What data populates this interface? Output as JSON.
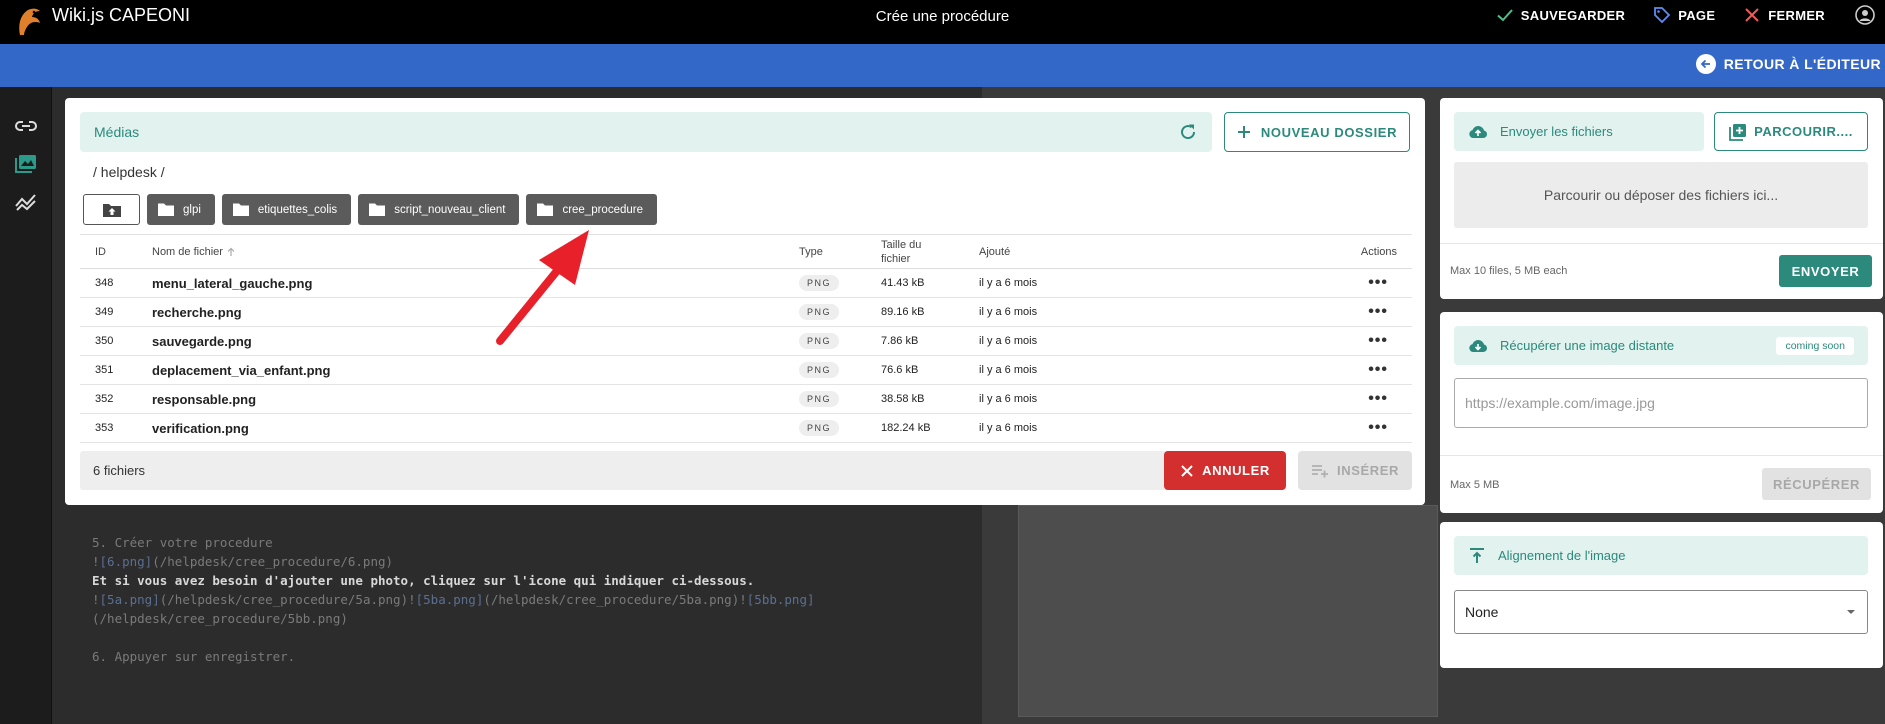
{
  "app": {
    "title": "Wiki.js CAPEONI",
    "page_title": "Crée une procédure"
  },
  "top_actions": {
    "save": "SAUVEGARDER",
    "page": "PAGE",
    "close": "FERMER"
  },
  "blue_bar": {
    "back_label": "RETOUR À L'ÉDITEUR"
  },
  "editor": {
    "lines": [
      {
        "parts": [
          {
            "t": "5. Créer votre procedure",
            "c": ""
          }
        ]
      },
      {
        "parts": [
          {
            "t": "!",
            "c": ""
          },
          {
            "t": "[6.png]",
            "c": "lnk"
          },
          {
            "t": "(/helpdesk/cree_procedure/6.png)",
            "c": ""
          }
        ]
      },
      {
        "parts": [
          {
            "t": "Et si vous avez besoin d'ajouter une photo, cliquez sur l'icone qui indiquer ci-dessous.",
            "c": "bright"
          }
        ]
      },
      {
        "parts": [
          {
            "t": "!",
            "c": ""
          },
          {
            "t": "[5a.png]",
            "c": "lnk"
          },
          {
            "t": "(/helpdesk/cree_procedure/5a.png)!",
            "c": ""
          },
          {
            "t": "[5ba.png]",
            "c": "lnk"
          },
          {
            "t": "(/helpdesk/cree_procedure/5ba.png)!",
            "c": ""
          },
          {
            "t": "[5bb.png]",
            "c": "lnk"
          }
        ]
      },
      {
        "parts": [
          {
            "t": "(/helpdesk/cree_procedure/5bb.png)",
            "c": ""
          }
        ]
      },
      {
        "parts": [
          {
            "t": " ",
            "c": ""
          }
        ]
      },
      {
        "parts": [
          {
            "t": "6. Appuyer sur enregistrer.",
            "c": ""
          }
        ]
      }
    ]
  },
  "media": {
    "label": "Médias",
    "new_folder": "NOUVEAU DOSSIER",
    "breadcrumb": "/ helpdesk /",
    "folders": [
      "glpi",
      "etiquettes_colis",
      "script_nouveau_client",
      "cree_procedure"
    ],
    "columns": {
      "id": "ID",
      "name": "Nom de fichier",
      "type": "Type",
      "size_line1": "Taille du",
      "size_line2": "fichier",
      "added": "Ajouté",
      "actions": "Actions"
    },
    "files": [
      {
        "id": "348",
        "name": "menu_lateral_gauche.png",
        "type": "PNG",
        "size": "41.43 kB",
        "added": "il y a 6 mois"
      },
      {
        "id": "349",
        "name": "recherche.png",
        "type": "PNG",
        "size": "89.16 kB",
        "added": "il y a 6 mois"
      },
      {
        "id": "350",
        "name": "sauvegarde.png",
        "type": "PNG",
        "size": "7.86 kB",
        "added": "il y a 6 mois"
      },
      {
        "id": "351",
        "name": "deplacement_via_enfant.png",
        "type": "PNG",
        "size": "76.6 kB",
        "added": "il y a 6 mois"
      },
      {
        "id": "352",
        "name": "responsable.png",
        "type": "PNG",
        "size": "38.58 kB",
        "added": "il y a 6 mois"
      },
      {
        "id": "353",
        "name": "verification.png",
        "type": "PNG",
        "size": "182.24 kB",
        "added": "il y a 6 mois"
      }
    ],
    "file_count": "6 fichiers",
    "cancel": "ANNULER",
    "insert": "INSÉRER"
  },
  "upload": {
    "title": "Envoyer les fichiers",
    "browse": "PARCOURIR....",
    "dropzone": "Parcourir ou déposer des fichiers ici...",
    "limits": "Max 10 files, 5 MB each",
    "send": "ENVOYER"
  },
  "remote": {
    "title": "Récupérer une image distante",
    "badge": "coming soon",
    "placeholder": "https://example.com/image.jpg",
    "limit": "Max 5 MB",
    "fetch": "RÉCUPÉRER"
  },
  "alignment": {
    "title": "Alignement de l'image",
    "value": "None"
  },
  "colors": {
    "teal": "#2b8a7c",
    "teal_light": "#e1f2ef",
    "blue_bar": "#3468c8",
    "danger": "#d32f2f",
    "arrow": "#e8202a"
  }
}
